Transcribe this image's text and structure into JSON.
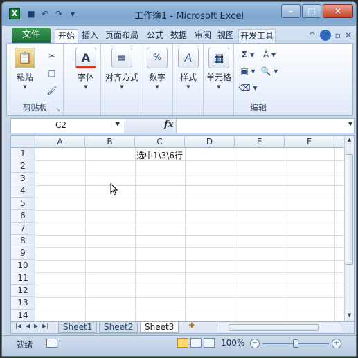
{
  "titlebar": {
    "title": "工作簿1 - Microsoft Excel",
    "app_icon": "X",
    "window_buttons": [
      "–",
      "□",
      "✕"
    ]
  },
  "tabs": {
    "file": "文件",
    "items": [
      "开始",
      "插入",
      "页面布局",
      "公式",
      "数据",
      "审阅",
      "视图",
      "开发工具"
    ]
  },
  "ribbon": {
    "clipboard": {
      "paste": "粘贴",
      "group": "剪贴板"
    },
    "font": {
      "label": "字体"
    },
    "align": {
      "label": "对齐方式"
    },
    "number": {
      "label": "数字"
    },
    "style": {
      "label": "样式"
    },
    "cells": {
      "label": "单元格"
    },
    "editing": {
      "group": "编辑"
    }
  },
  "formula_bar": {
    "name_box": "C2",
    "fx": "fx",
    "value": ""
  },
  "grid": {
    "columns": [
      "A",
      "B",
      "C",
      "D",
      "E",
      "F"
    ],
    "rows": [
      "1",
      "2",
      "3",
      "4",
      "5",
      "6",
      "7",
      "8",
      "9",
      "10",
      "11",
      "12",
      "13",
      "14"
    ],
    "cell_C1": "选中1\\3\\6行"
  },
  "sheets": {
    "tabs": [
      "Sheet1",
      "Sheet2",
      "Sheet3"
    ],
    "active": "Sheet3"
  },
  "status": {
    "ready": "就绪",
    "zoom": "100%"
  }
}
